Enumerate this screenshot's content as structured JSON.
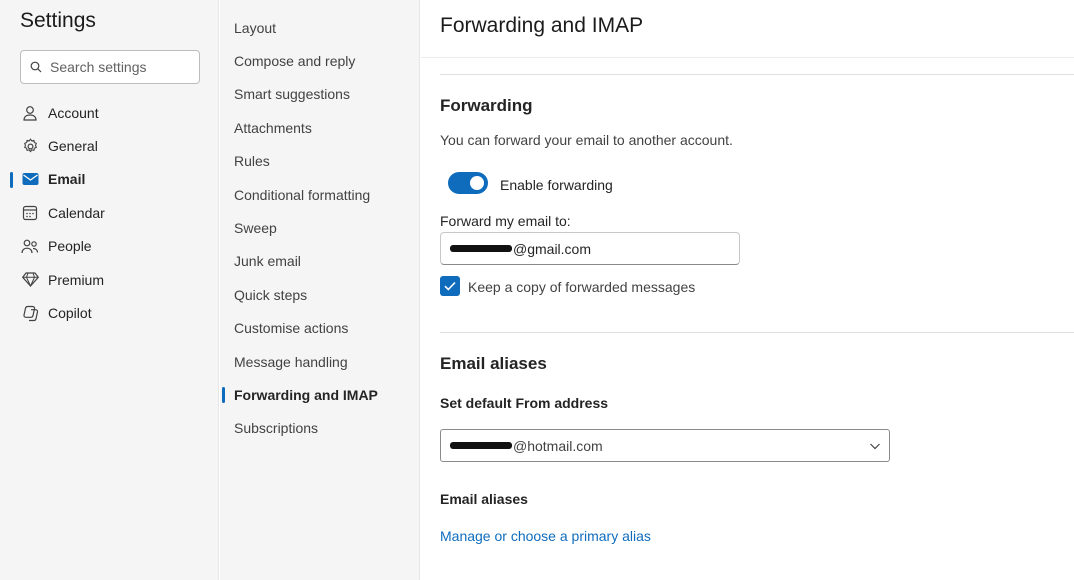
{
  "settings_nav": {
    "title": "Settings",
    "search_placeholder": "Search settings",
    "items": [
      {
        "label": "Account",
        "icon": "person-icon"
      },
      {
        "label": "General",
        "icon": "gear-icon"
      },
      {
        "label": "Email",
        "icon": "mail-icon",
        "active": true
      },
      {
        "label": "Calendar",
        "icon": "calendar-icon"
      },
      {
        "label": "People",
        "icon": "people-icon"
      },
      {
        "label": "Premium",
        "icon": "diamond-icon"
      },
      {
        "label": "Copilot",
        "icon": "copilot-icon"
      }
    ]
  },
  "email_nav": {
    "items": [
      "Layout",
      "Compose and reply",
      "Smart suggestions",
      "Attachments",
      "Rules",
      "Conditional formatting",
      "Sweep",
      "Junk email",
      "Quick steps",
      "Customise actions",
      "Message handling",
      "Forwarding and IMAP",
      "Subscriptions"
    ],
    "active_index": 11
  },
  "content": {
    "title": "Forwarding and IMAP",
    "forwarding": {
      "heading": "Forwarding",
      "description": "You can forward your email to another account.",
      "toggle_label": "Enable forwarding",
      "toggle_on": true,
      "forward_to_label": "Forward my email to:",
      "forward_to_value": "@gmail.com",
      "keep_copy_label": "Keep a copy of forwarded messages",
      "keep_copy_checked": true
    },
    "aliases": {
      "heading": "Email aliases",
      "default_from_label": "Set default From address",
      "default_from_value": "@hotmail.com",
      "aliases_label": "Email aliases",
      "manage_link": "Manage or choose a primary alias"
    }
  },
  "colors": {
    "accent": "#0f6cbd",
    "nav_background": "#f5f5f5"
  }
}
